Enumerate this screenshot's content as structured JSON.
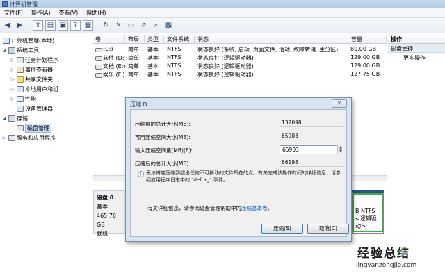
{
  "window": {
    "title": "计算机管理"
  },
  "menu": [
    "文件(F)",
    "操作(A)",
    "查看(V)",
    "帮助(H)"
  ],
  "toolbar": {
    "icons": [
      "back-icon",
      "forward-icon",
      "up-folder-icon",
      "show-tree-icon",
      "properties-icon",
      "help-icon",
      "refresh-icon",
      "delete-icon",
      "open-icon",
      "export-icon",
      "search-icon",
      "help-book-icon"
    ]
  },
  "tree": {
    "root": "计算机管理(本地)",
    "system_tools": "系统工具",
    "task_scheduler": "任务计划程序",
    "event_viewer": "事件查看器",
    "shared_folders": "共享文件夹",
    "local_users": "本地用户和组",
    "performance": "性能",
    "device_manager": "设备管理器",
    "storage": "存储",
    "disk_management": "磁盘管理",
    "services": "服务和应用程序"
  },
  "list": {
    "headers": [
      "卷",
      "布局",
      "类型",
      "文件系统",
      "状态",
      "容量"
    ],
    "rows": [
      {
        "vol": "(C:)",
        "layout": "简单",
        "type": "基本",
        "fs": "NTFS",
        "status": "状态良好 (系统, 启动, 页面文件, 活动, 故障转储, 主分区)",
        "cap": "80.00 GB"
      },
      {
        "vol": "软件 (D:)",
        "layout": "简单",
        "type": "基本",
        "fs": "NTFS",
        "status": "状态良好 (逻辑驱动器)",
        "cap": "129.00 GB"
      },
      {
        "vol": "文档 (E:)",
        "layout": "简单",
        "type": "基本",
        "fs": "NTFS",
        "status": "状态良好 (逻辑驱动器)",
        "cap": "129.00 GB"
      },
      {
        "vol": "娱乐 (F:)",
        "layout": "简单",
        "type": "基本",
        "fs": "NTFS",
        "status": "状态良好 (逻辑驱动器)",
        "cap": "127.75 GB"
      }
    ]
  },
  "disk": {
    "name": "磁盘 0",
    "type": "基本",
    "size": "465.76 GB",
    "state": "联机",
    "partition_fs": "B NTFS",
    "partition_status": "<逻辑驱动>"
  },
  "actions": {
    "header": "操作",
    "section": "磁盘管理",
    "more": "更多操作"
  },
  "dialog": {
    "title": "压缩 D:",
    "close": "✕",
    "label_total_before": "压缩前的总计大小(MB):",
    "value_total_before": "132098",
    "label_available": "可用压缩空间大小(MB):",
    "value_available": "65903",
    "label_input": "输入压缩空间量(MB)(E):",
    "value_input": "65903",
    "label_total_after": "压缩后的总计大小(MB):",
    "value_total_after": "66195",
    "note": "无法将卷压缩到超出任何不可移动的文件所在的点。有关完成该操作时间的详细信息，请参阅应用程序日志中的 \"defrag\" 事件。",
    "help_prefix": "有关详细信息，请参阅磁盘管理帮助中的",
    "help_link": "压缩基本卷",
    "help_suffix": "。",
    "btn_compress": "压缩(S)",
    "btn_cancel": "取消(C)"
  },
  "watermark": {
    "name": "经验总结",
    "check": "✓",
    "url": "jingyanzongjie.com"
  }
}
